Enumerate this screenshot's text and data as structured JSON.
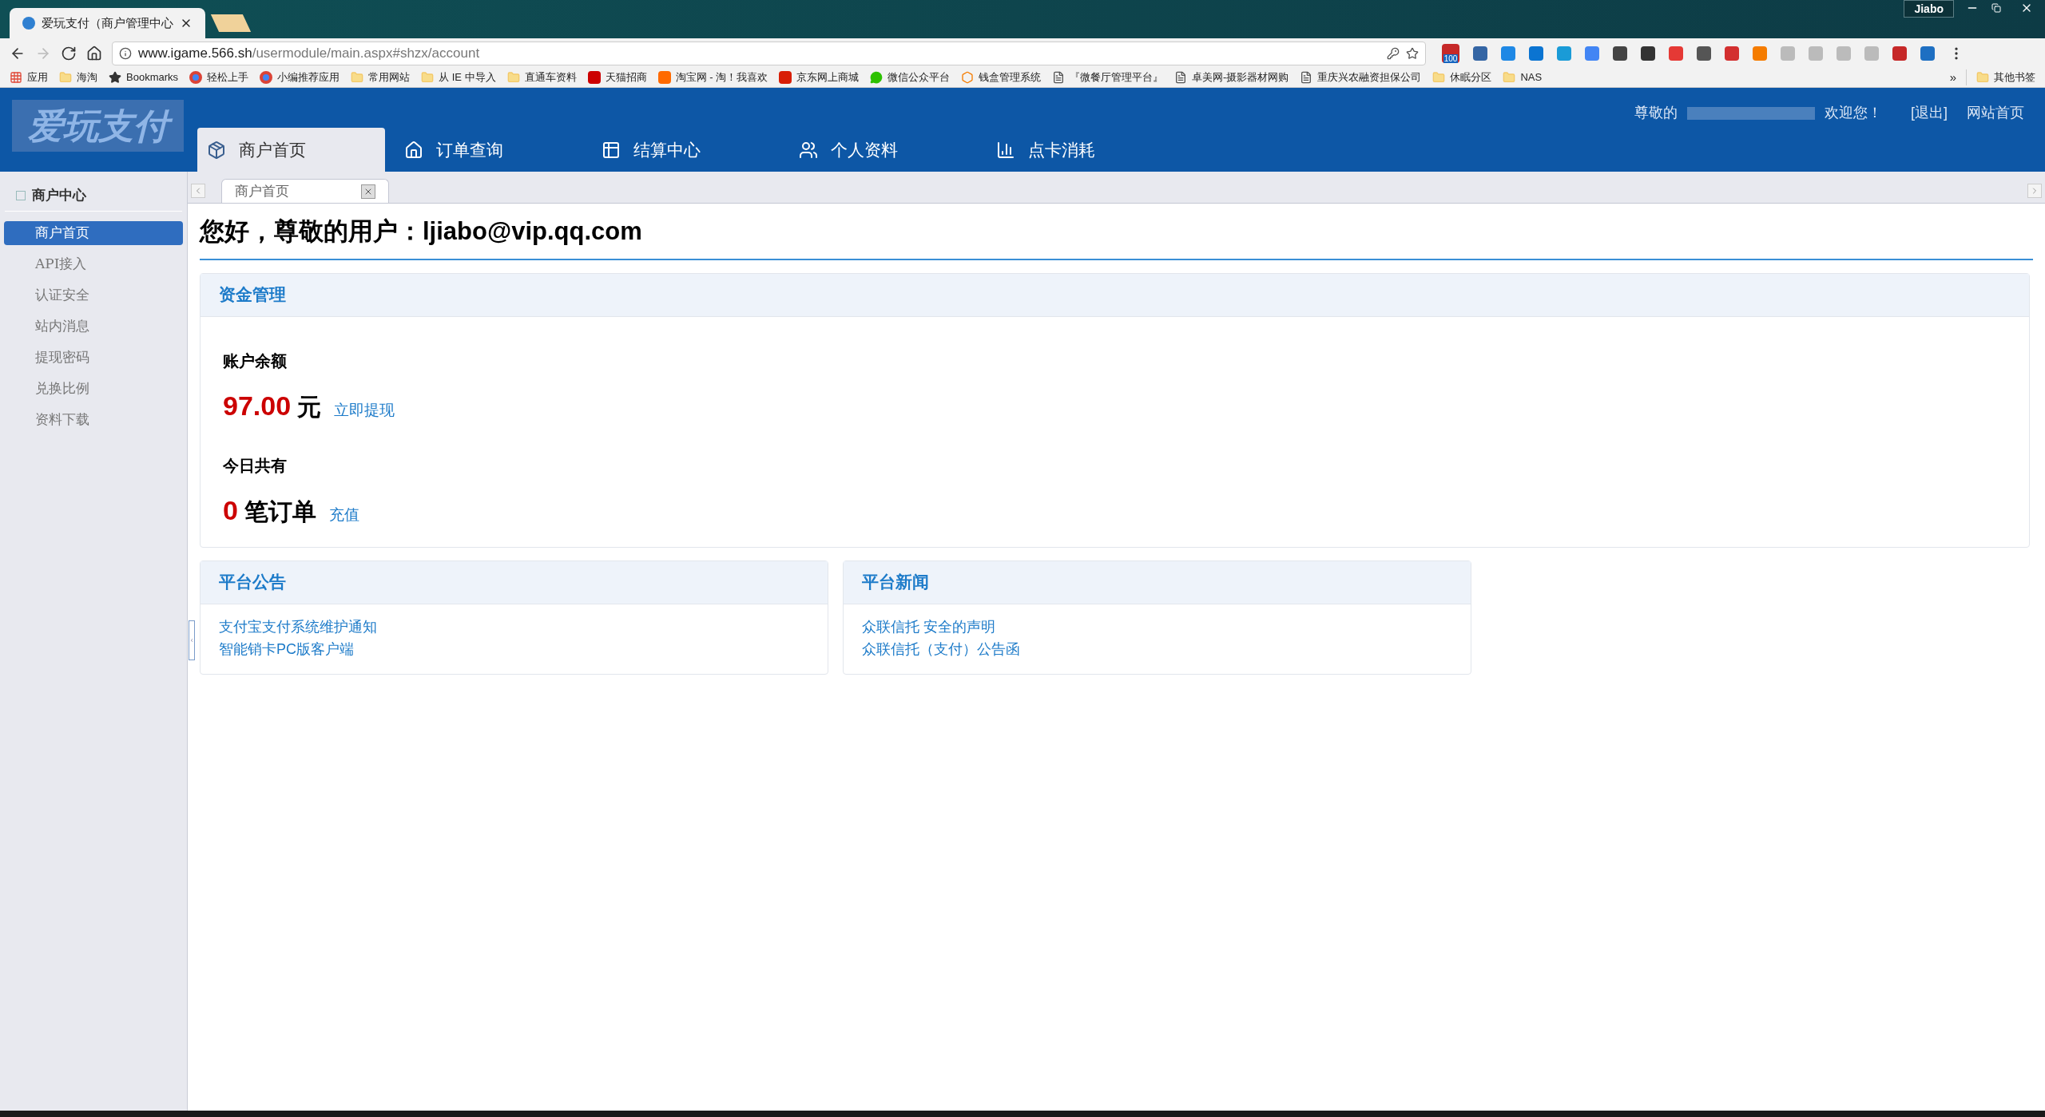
{
  "browser": {
    "tab_title": "爱玩支付（商户管理中心",
    "profile": "Jiabo",
    "url_host": "www.igame.566.sh",
    "url_path": "/usermodule/main.aspx#shzx/account",
    "extension_badge": "100",
    "bookmarks": [
      {
        "label": "应用",
        "kind": "apps"
      },
      {
        "label": "海淘",
        "kind": "folder"
      },
      {
        "label": "Bookmarks",
        "kind": "star"
      },
      {
        "label": "轻松上手",
        "kind": "chrome"
      },
      {
        "label": "小编推荐应用",
        "kind": "chrome"
      },
      {
        "label": "常用网站",
        "kind": "folder"
      },
      {
        "label": "从 IE 中导入",
        "kind": "folder"
      },
      {
        "label": "直通车资料",
        "kind": "folder"
      },
      {
        "label": "天猫招商",
        "kind": "tmall"
      },
      {
        "label": "淘宝网 - 淘！我喜欢",
        "kind": "taobao"
      },
      {
        "label": "京东网上商城",
        "kind": "jd"
      },
      {
        "label": "微信公众平台",
        "kind": "wechat"
      },
      {
        "label": "钱盒管理系统",
        "kind": "hex"
      },
      {
        "label": "『微餐厅管理平台』",
        "kind": "page"
      },
      {
        "label": "卓美网-摄影器材网购",
        "kind": "page"
      },
      {
        "label": "重庆兴农融资担保公司",
        "kind": "page"
      },
      {
        "label": "休眠分区",
        "kind": "folder"
      },
      {
        "label": "NAS",
        "kind": "folder"
      }
    ],
    "overflow": "»",
    "other_bookmarks": "其他书签"
  },
  "header": {
    "logo": "爱玩支付",
    "greeting": "尊敬的",
    "welcome": "欢迎您！",
    "logout": "[退出]",
    "site_home": "网站首页",
    "nav": [
      {
        "label": "商户首页",
        "kind": "box",
        "selected": true
      },
      {
        "label": "订单查询",
        "kind": "home",
        "selected": false
      },
      {
        "label": "结算中心",
        "kind": "table",
        "selected": false
      },
      {
        "label": "个人资料",
        "kind": "users",
        "selected": false
      },
      {
        "label": "点卡消耗",
        "kind": "chart",
        "selected": false
      }
    ]
  },
  "sidebar": {
    "title": "商户中心",
    "items": [
      {
        "label": "商户首页",
        "selected": true
      },
      {
        "label": "API接入",
        "selected": false
      },
      {
        "label": "认证安全",
        "selected": false
      },
      {
        "label": "站内消息",
        "selected": false
      },
      {
        "label": "提现密码",
        "selected": false
      },
      {
        "label": "兑换比例",
        "selected": false
      },
      {
        "label": "资料下载",
        "selected": false
      }
    ]
  },
  "page_tabs": [
    {
      "label": "商户首页",
      "selected": true
    }
  ],
  "content": {
    "heading": "您好，尊敬的用户：ljiabo@vip.qq.com",
    "funds": {
      "title": "资金管理",
      "balance_label": "账户余额",
      "balance": "97.00",
      "balance_unit": "元",
      "withdraw": "立即提现",
      "today_label": "今日共有",
      "orders": "0",
      "orders_unit": "笔订单",
      "recharge": "充值"
    },
    "panels": [
      {
        "title": "平台公告",
        "links": [
          "支付宝支付系统维护通知",
          "智能销卡PC版客户端"
        ]
      },
      {
        "title": "平台新闻",
        "links": [
          "众联信托 安全的声明",
          "众联信托（支付）公告函"
        ]
      }
    ]
  }
}
